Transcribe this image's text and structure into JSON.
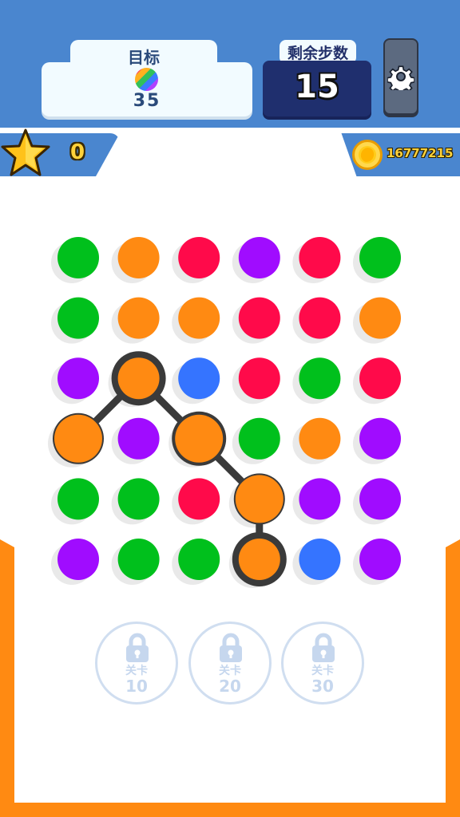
{
  "header": {
    "goal_label": "目标",
    "goal_count": "35",
    "moves_label": "剩余步数",
    "moves_value": "15",
    "settings_icon": "gear-icon"
  },
  "status": {
    "stars": "0",
    "coins": "16777215",
    "star_icon": "star-icon",
    "coin_icon": "coin-icon"
  },
  "colors": {
    "green": "#00c01c",
    "orange": "#ff8a12",
    "red": "#ff0a4a",
    "purple": "#a00cff",
    "blue": "#3574ff",
    "frame": "#ff8a12",
    "header": "#4a86cf",
    "path": "#3a3a3a"
  },
  "board": {
    "rows": [
      [
        "green",
        "orange",
        "red",
        "purple",
        "red",
        "green"
      ],
      [
        "green",
        "orange",
        "orange",
        "red",
        "red",
        "orange"
      ],
      [
        "purple",
        "orange",
        "blue",
        "red",
        "green",
        "red"
      ],
      [
        "orange",
        "purple",
        "orange",
        "green",
        "orange",
        "purple"
      ],
      [
        "green",
        "green",
        "red",
        "orange",
        "purple",
        "purple"
      ],
      [
        "purple",
        "green",
        "green",
        "orange",
        "blue",
        "purple"
      ]
    ],
    "selected_path": [
      [
        5,
        3
      ],
      [
        4,
        3
      ],
      [
        3,
        2
      ],
      [
        2,
        1
      ],
      [
        3,
        0
      ]
    ]
  },
  "locked_levels": [
    {
      "label": "关卡",
      "level": "10"
    },
    {
      "label": "关卡",
      "level": "20"
    },
    {
      "label": "关卡",
      "level": "30"
    }
  ]
}
